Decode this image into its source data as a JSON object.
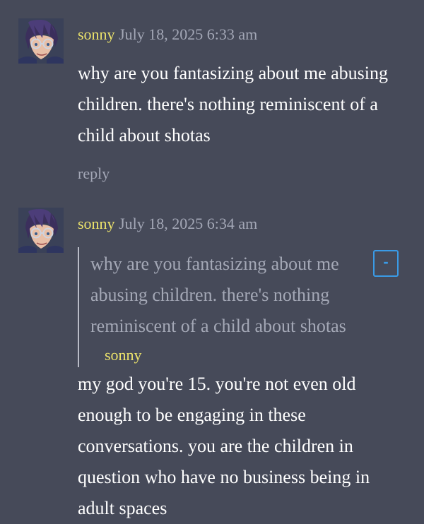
{
  "comments": [
    {
      "author": "sonny",
      "timestamp": "July 18, 2025 6:33 am",
      "text": "why are you fantasizing about me abusing children. there's nothing reminiscent of a child about shotas",
      "reply_label": "reply",
      "avatar_icon": "anime-character-avatar-icon"
    },
    {
      "author": "sonny",
      "timestamp": "July 18, 2025 6:34 am",
      "avatar_icon": "anime-character-avatar-icon",
      "quote": {
        "text": "why are you fantasizing about me abusing children. there's nothing reminiscent of a child about shotas",
        "author": "sonny",
        "collapse_label": "-"
      },
      "text": "my god you're 15. you're not even old enough to be engaging in these conversations. you are the children in question who have no business being in adult spaces"
    }
  ],
  "colors": {
    "background": "#464a59",
    "author": "#ece36b",
    "timestamp": "#a3a7b6",
    "body_text": "#ffffff",
    "quote_text": "#a4a8b6",
    "collapse_button": "#3a9be6"
  }
}
